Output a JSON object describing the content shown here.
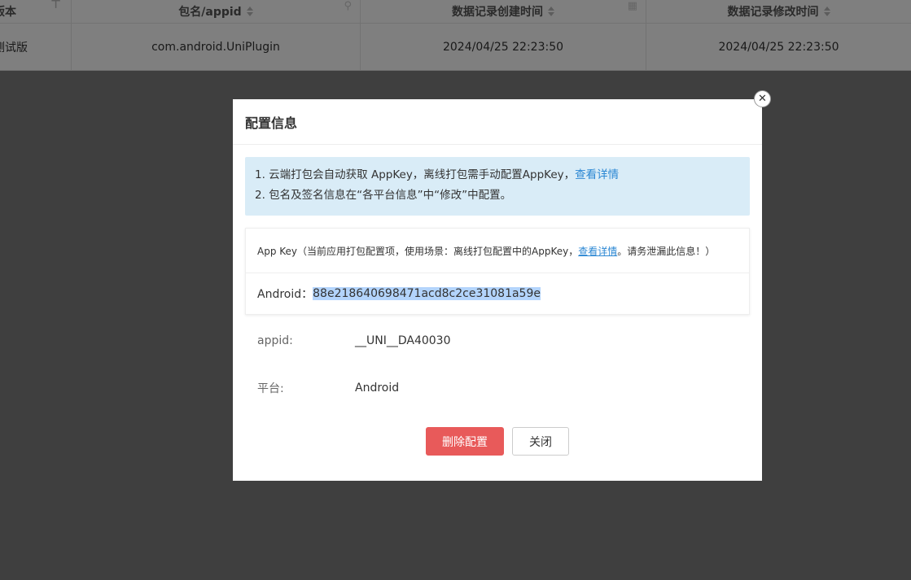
{
  "table": {
    "headers": [
      "版本",
      "包名/appid",
      "数据记录创建时间",
      "数据记录修改时间"
    ],
    "rows": [
      [
        "测试版",
        "com.android.UniPlugin",
        "2024/04/25 22:23:50",
        "2024/04/25 22:23:50"
      ]
    ]
  },
  "modal": {
    "title": "配置信息",
    "close_glyph": "✕",
    "notice": {
      "line1": "1. 云端打包会自动获取 AppKey，离线打包需手动配置AppKey，",
      "line1_link": "查看详情",
      "line2": "2. 包名及签名信息在“各平台信息”中“修改”中配置。"
    },
    "appkey": {
      "head_prefix": "App Key（当前应用打包配置项，使用场景：离线打包配置中的AppKey，",
      "head_link": "查看详情",
      "head_suffix": "。请务泄漏此信息！）",
      "platform_label": "Android：",
      "key_value": "88e218640698471acd8c2ce31081a59e"
    },
    "fields": [
      {
        "label": "appid:",
        "value": "__UNI__DA40030"
      },
      {
        "label": "平台:",
        "value": "Android"
      }
    ],
    "buttons": {
      "delete": "删除配置",
      "close": "关闭"
    }
  },
  "colors": {
    "overlay": "#7f7f7f",
    "notice_bg": "#d9ecf7",
    "link": "#2b87d3",
    "danger": "#e85a5a"
  }
}
